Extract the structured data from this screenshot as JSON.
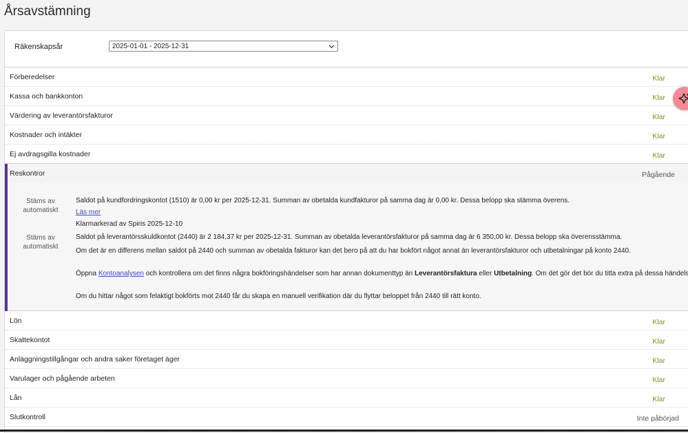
{
  "page": {
    "title": "Årsavstämning"
  },
  "fiscal_year": {
    "label": "Räkenskapsår",
    "selected": "2025-01-01 - 2025-12-31"
  },
  "colors": {
    "done": "#6a9a1f",
    "accent": "#5b3390",
    "fab": "#f28b97"
  },
  "sections_before": [
    {
      "name": "Förberedelser",
      "status": "Klar"
    },
    {
      "name": "Kassa och bankkonton",
      "status": "Klar"
    },
    {
      "name": "Värdering av leverantörsfakturor",
      "status": "Klar"
    },
    {
      "name": "Kostnader och intäkter",
      "status": "Klar"
    },
    {
      "name": "Ej avdragsgilla kostnader",
      "status": "Klar"
    }
  ],
  "expanded_section": {
    "name": "Reskontror",
    "status": "Pågående",
    "checks": [
      {
        "label_line1": "Stäms av",
        "label_line2": "automatiskt",
        "text": "Saldot på kundfordringskontot (1510) är 0,00 kr per 2025-12-31. Summan av obetalda kundfakturor på samma dag är 0,00 kr. Dessa belopp ska stämma överens.",
        "link": "Läs mer",
        "note": "Klarmarkerad av Spiris 2025-12-10"
      },
      {
        "label_line1": "Stäms av",
        "label_line2": "automatiskt",
        "text": "Saldot på leverantörsskuldkontot (2440) är 2 184,37 kr per 2025-12-31. Summan av obetalda leverantörsfakturor på samma dag är 6 350,00 kr. Dessa belopp ska överensstämma.",
        "text2": "Om det är en differens mellan saldot på 2440 och summan av obetalda fakturor kan det bero på att du har bokfört något annat än leverantörsfakturor och utbetalningar på konto 2440.",
        "text3_pre": "Öppna",
        "text3_link": "Kontoanalysen",
        "text3_mid": "och kontrollera om det finns några bokföringshändelser som har annan dokumenttyp än",
        "text3_bold1": "Leverantörsfaktura",
        "text3_or": "eller",
        "text3_bold2": "Utbetalning",
        "text3_post": ". Om det gör det bör du titta extra på dessa händelser.",
        "text4": "Om du hittar något som felaktigt bokförts mot 2440 får du skapa en manuell verifikation där du flyttar beloppet från 2440 till rätt konto."
      }
    ]
  },
  "sections_after": [
    {
      "name": "Lön",
      "status": "Klar"
    },
    {
      "name": "Skattekontot",
      "status": "Klar"
    },
    {
      "name": "Anläggningstillgångar och andra saker företaget äger",
      "status": "Klar"
    },
    {
      "name": "Varulager och pågående arbeten",
      "status": "Klar"
    },
    {
      "name": "Lån",
      "status": "Klar"
    },
    {
      "name": "Slutkontroll",
      "status": "Inte påbörjad"
    }
  ]
}
